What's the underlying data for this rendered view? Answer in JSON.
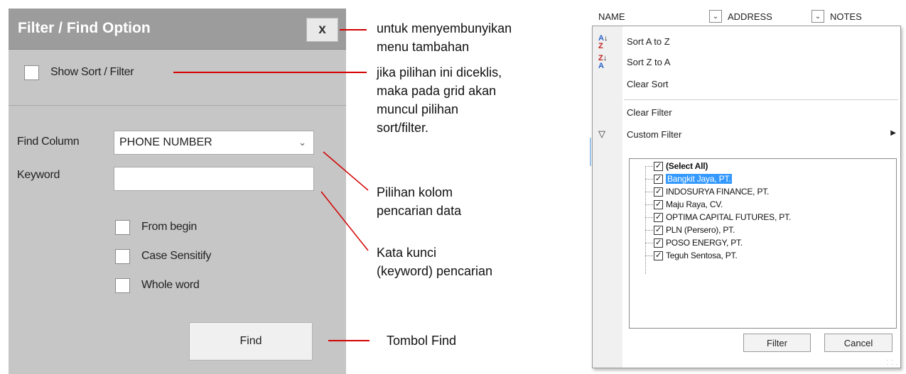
{
  "filter_panel": {
    "title": "Filter / Find Option",
    "close_label": "x",
    "show_sort_filter_label": "Show Sort / Filter",
    "find_column_label": "Find Column",
    "find_column_value": "PHONE NUMBER",
    "keyword_label": "Keyword",
    "keyword_value": "",
    "options": [
      {
        "label": "From begin",
        "checked": false
      },
      {
        "label": "Case Sensitify",
        "checked": false
      },
      {
        "label": "Whole word",
        "checked": false
      }
    ],
    "find_button_label": "Find"
  },
  "annotations": {
    "close_note": [
      "untuk menyembunyikan",
      "menu tambahan"
    ],
    "sort_note": [
      "jika pilihan ini diceklis,",
      "maka pada grid akan",
      "muncul pilihan",
      "sort/filter."
    ],
    "column_note": [
      "Pilihan kolom",
      "pencarian data"
    ],
    "keyword_note": [
      "Kata kunci",
      "(keyword) pencarian"
    ],
    "find_note": [
      "Tombol Find"
    ],
    "line_color": "#d40000"
  },
  "grid": {
    "columns": [
      "NAME",
      "ADDRESS",
      "NOTES"
    ],
    "menu": {
      "sort_asc": "Sort A to Z",
      "sort_desc": "Sort Z to A",
      "clear_sort": "Clear Sort",
      "clear_filter": "Clear Filter",
      "custom_filter": "Custom Filter"
    },
    "filter_items": [
      {
        "label": "(Select All)",
        "checked": true,
        "bold": true,
        "selected": false
      },
      {
        "label": "Bangkit Jaya, PT.",
        "checked": true,
        "bold": false,
        "selected": true
      },
      {
        "label": "INDOSURYA FINANCE, PT.",
        "checked": true,
        "bold": false,
        "selected": false
      },
      {
        "label": "Maju Raya, CV.",
        "checked": true,
        "bold": false,
        "selected": false
      },
      {
        "label": "OPTIMA CAPITAL FUTURES, PT.",
        "checked": true,
        "bold": false,
        "selected": false
      },
      {
        "label": "PLN (Persero), PT.",
        "checked": true,
        "bold": false,
        "selected": false
      },
      {
        "label": "POSO ENERGY, PT.",
        "checked": true,
        "bold": false,
        "selected": false
      },
      {
        "label": "Teguh Sentosa, PT.",
        "checked": true,
        "bold": false,
        "selected": false
      }
    ],
    "filter_button_label": "Filter",
    "cancel_button_label": "Cancel",
    "selection_color": "#3399ff"
  }
}
